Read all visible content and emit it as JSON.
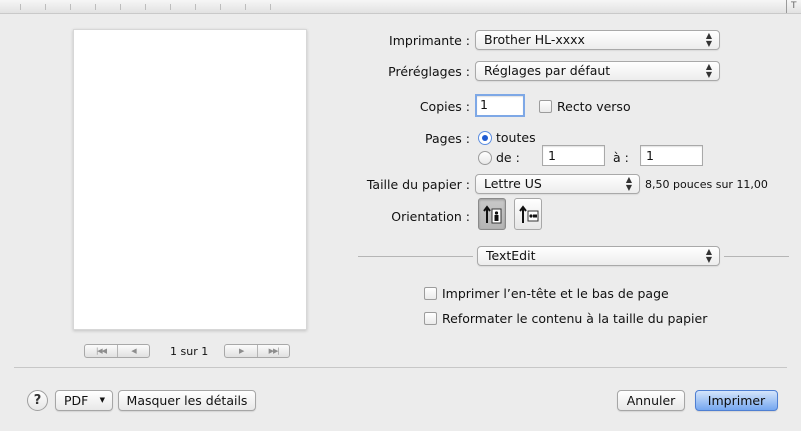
{
  "ruler": {
    "corner_mark": "T"
  },
  "preview": {
    "page_count": "1 sur 1",
    "first_icon": "first-page-icon",
    "prev_icon": "previous-page-icon",
    "next_icon": "next-page-icon",
    "last_icon": "last-page-icon"
  },
  "printer": {
    "label": "Imprimante :",
    "value": "Brother HL-xxxx"
  },
  "presets": {
    "label": "Préréglages :",
    "value": "Réglages par défaut"
  },
  "copies": {
    "label": "Copies :",
    "value": "1",
    "duplex_label": "Recto verso",
    "duplex_checked": false
  },
  "pages": {
    "label": "Pages :",
    "all_label": "toutes",
    "range_label": "de :",
    "from_value": "1",
    "to_label": "à :",
    "to_value": "1",
    "selected": "all"
  },
  "paper": {
    "label": "Taille du papier :",
    "value": "Lettre US",
    "dimensions": "8,50 pouces sur 11,00"
  },
  "orientation": {
    "label": "Orientation :",
    "portrait_icon": "portrait-orientation-icon",
    "landscape_icon": "landscape-orientation-icon",
    "selected": "portrait"
  },
  "app_section": {
    "value": "TextEdit"
  },
  "options": {
    "header_footer_label": "Imprimer l’en-tête et le bas de page",
    "rewrap_label": "Reformater le contenu à la taille du papier"
  },
  "footer": {
    "help_symbol": "?",
    "pdf_label": "PDF",
    "pdf_arrow": "▼",
    "hide_details_label": "Masquer les détails",
    "cancel_label": "Annuler",
    "print_label": "Imprimer"
  },
  "colors": {
    "accent": "#76a7f0",
    "focus_ring": "#7ea8e6",
    "background": "#ececec"
  }
}
